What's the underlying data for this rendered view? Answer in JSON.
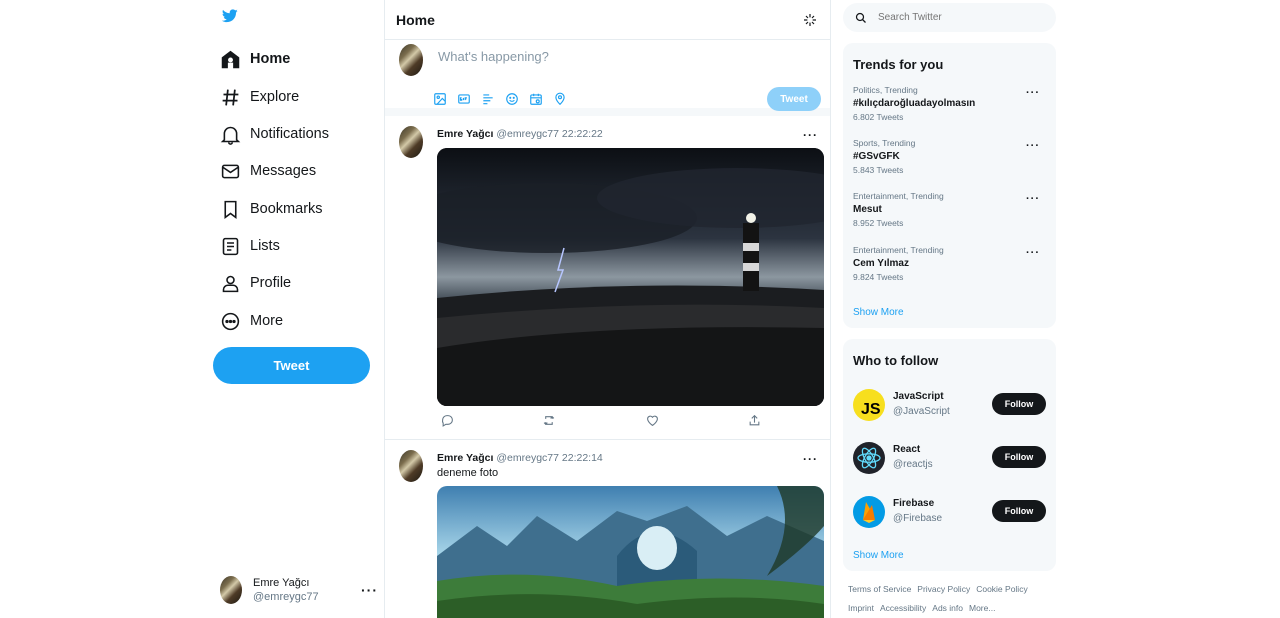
{
  "nav": {
    "items": [
      {
        "label": "Home",
        "icon": "home-icon"
      },
      {
        "label": "Explore",
        "icon": "hashtag-icon"
      },
      {
        "label": "Notifications",
        "icon": "bell-icon"
      },
      {
        "label": "Messages",
        "icon": "envelope-icon"
      },
      {
        "label": "Bookmarks",
        "icon": "bookmark-icon"
      },
      {
        "label": "Lists",
        "icon": "list-icon"
      },
      {
        "label": "Profile",
        "icon": "user-icon"
      },
      {
        "label": "More",
        "icon": "more-circle-icon"
      }
    ],
    "tweet_button": "Tweet"
  },
  "account": {
    "name": "Emre Yağcı",
    "handle": "@emreygc77"
  },
  "header": {
    "title": "Home"
  },
  "compose": {
    "placeholder": "What's happening?",
    "tweet_button": "Tweet"
  },
  "posts": [
    {
      "name": "Emre Yağcı",
      "handle": "@emreygc77",
      "time": "22:22:22",
      "text": ""
    },
    {
      "name": "Emre Yağcı",
      "handle": "@emreygc77",
      "time": "22:22:14",
      "text": "deneme foto"
    }
  ],
  "search": {
    "placeholder": "Search Twitter"
  },
  "trends": {
    "title": "Trends for you",
    "items": [
      {
        "context": "Politics, Trending",
        "topic": "#kılıçdaroğluadayolmasın",
        "count": "6.802 Tweets"
      },
      {
        "context": "Sports, Trending",
        "topic": "#GSvGFK",
        "count": "5.843 Tweets"
      },
      {
        "context": "Entertainment, Trending",
        "topic": "Mesut",
        "count": "8.952 Tweets"
      },
      {
        "context": "Entertainment, Trending",
        "topic": "Cem Yılmaz",
        "count": "9.824 Tweets"
      }
    ],
    "show_more": "Show More"
  },
  "who_to_follow": {
    "title": "Who to follow",
    "items": [
      {
        "name": "JavaScript",
        "handle": "@JavaScript",
        "button": "Follow"
      },
      {
        "name": "React",
        "handle": "@reactjs",
        "button": "Follow"
      },
      {
        "name": "Firebase",
        "handle": "@Firebase",
        "button": "Follow"
      }
    ],
    "show_more": "Show More"
  },
  "footer": {
    "links": [
      "Terms of Service",
      "Privacy Policy",
      "Cookie Policy",
      "Imprint",
      "Accessibility",
      "Ads info",
      "More..."
    ]
  },
  "colors": {
    "accent": "#1da1f2",
    "text": "#14171a",
    "muted": "#657786",
    "panel": "#f5f8fa"
  }
}
